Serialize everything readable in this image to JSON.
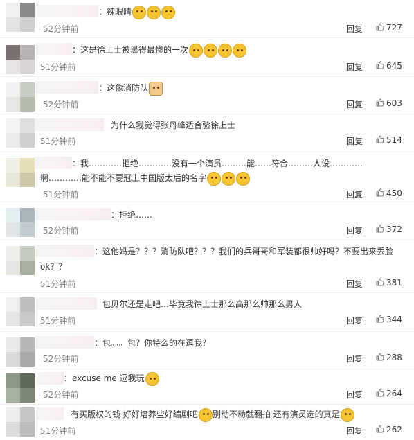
{
  "comments": [
    {
      "text": "：辣眼睛",
      "time": "52分钟前",
      "likes": "727",
      "emojis": [
        "smile",
        "smile",
        "smile"
      ]
    },
    {
      "text": "：这是徐上士被黑得最惨的一次",
      "time": "51分钟前",
      "likes": "645",
      "emojis": [
        "plain",
        "plain",
        "plain",
        "plain"
      ]
    },
    {
      "text": "：这像消防队",
      "time": "52分钟前",
      "likes": "603",
      "emojis": [
        "doge"
      ]
    },
    {
      "text": "为什么我觉得张丹峰适合验徐上士",
      "time": "51分钟前",
      "likes": "514",
      "emojis": []
    },
    {
      "text": "：我…………拒绝…………没有一个演员………能……符合………人设…………",
      "text2": "啊…………能不能不要冠上中国版太后的名字",
      "time": "51分钟前",
      "likes": "450",
      "emojis": [
        "smile",
        "smile",
        "smile"
      ]
    },
    {
      "text": "：拒绝……",
      "time": "52分钟前",
      "likes": "372",
      "emojis": []
    },
    {
      "text": "：这他妈是？？？消防队吧？？？我们的兵哥哥和军装都很帅好吗？不要出来丢脸",
      "text2": "ok？？",
      "time": "51分钟前",
      "likes": "381",
      "emojis": []
    },
    {
      "text": "包贝尔还是走吧…毕竟我徐上士那么高那么帅那么男人",
      "time": "51分钟前",
      "likes": "344",
      "emojis": []
    },
    {
      "text": "：包。。。包？你特么的在逗我？",
      "time": "52分钟前",
      "likes": "288",
      "emojis": []
    },
    {
      "text": "：excuse me 逗我玩",
      "time": "52分钟前",
      "likes": "264",
      "emojis": [
        "plain"
      ]
    },
    {
      "text": "有买版权的钱 好好培养些好编剧吧",
      "text_mid": "别动不动就翻拍 还有演员选的真是",
      "time": "51分钟前",
      "likes": "262",
      "emojis": [
        "smile"
      ]
    }
  ],
  "labels": {
    "reply": "回复"
  },
  "colors": {
    "time": "#808080",
    "divider": "#eeeeee",
    "emoji": "#f5c431"
  }
}
